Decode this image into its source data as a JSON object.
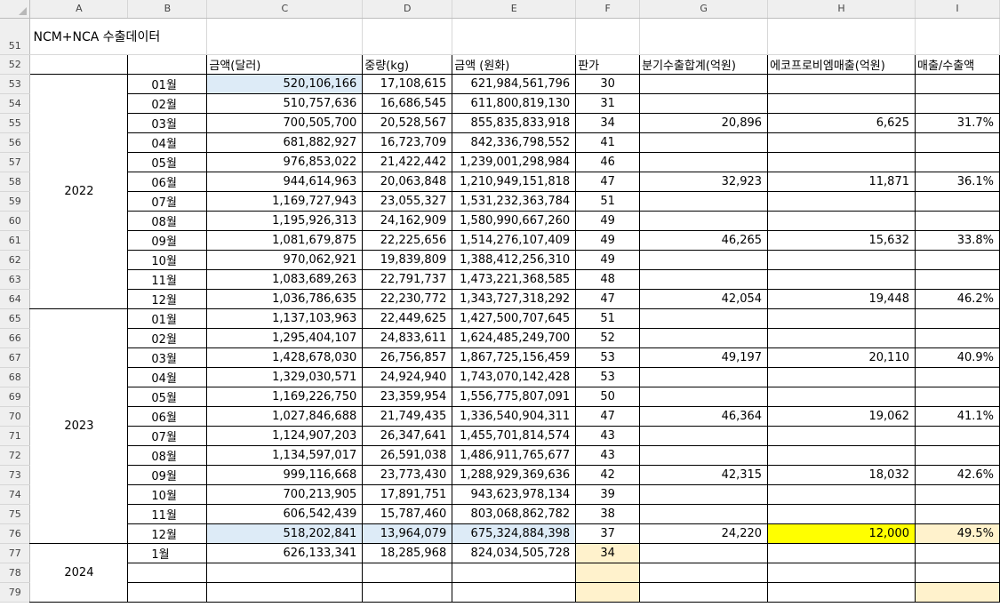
{
  "columns": [
    "A",
    "B",
    "C",
    "D",
    "E",
    "F",
    "G",
    "H",
    "I"
  ],
  "title_row": {
    "row_number": "51",
    "text": "NCM+NCA 수출데이터"
  },
  "header_row": {
    "row_number": "52",
    "labels": [
      "",
      "",
      "금액(달러)",
      "중량(kg)",
      "금액 (원화)",
      "판가",
      "분기수출합계(억원)",
      "에코프로비엠매출(억원)",
      "매출/수출액"
    ]
  },
  "years": [
    {
      "label": "2022",
      "row_start": 53,
      "row_span": 12
    },
    {
      "label": "2023",
      "row_start": 65,
      "row_span": 12
    },
    {
      "label": "2024",
      "row_start": 77,
      "row_span": 3
    }
  ],
  "rows": [
    {
      "n": "53",
      "month": "01월",
      "usd": "520,106,166",
      "kg": "17,108,615",
      "krw": "621,984,561,796",
      "price": "30",
      "q_total": "",
      "ecopro": "",
      "ratio": ""
    },
    {
      "n": "54",
      "month": "02월",
      "usd": "510,757,636",
      "kg": "16,686,545",
      "krw": "611,800,819,130",
      "price": "31",
      "q_total": "",
      "ecopro": "",
      "ratio": ""
    },
    {
      "n": "55",
      "month": "03월",
      "usd": "700,505,700",
      "kg": "20,528,567",
      "krw": "855,835,833,918",
      "price": "34",
      "q_total": "20,896",
      "ecopro": "6,625",
      "ratio": "31.7%"
    },
    {
      "n": "56",
      "month": "04월",
      "usd": "681,882,927",
      "kg": "16,723,709",
      "krw": "842,336,798,552",
      "price": "41",
      "q_total": "",
      "ecopro": "",
      "ratio": ""
    },
    {
      "n": "57",
      "month": "05월",
      "usd": "976,853,022",
      "kg": "21,422,442",
      "krw": "1,239,001,298,984",
      "price": "46",
      "q_total": "",
      "ecopro": "",
      "ratio": ""
    },
    {
      "n": "58",
      "month": "06월",
      "usd": "944,614,963",
      "kg": "20,063,848",
      "krw": "1,210,949,151,818",
      "price": "47",
      "q_total": "32,923",
      "ecopro": "11,871",
      "ratio": "36.1%"
    },
    {
      "n": "59",
      "month": "07월",
      "usd": "1,169,727,943",
      "kg": "23,055,327",
      "krw": "1,531,232,363,784",
      "price": "51",
      "q_total": "",
      "ecopro": "",
      "ratio": ""
    },
    {
      "n": "60",
      "month": "08월",
      "usd": "1,195,926,313",
      "kg": "24,162,909",
      "krw": "1,580,990,667,260",
      "price": "49",
      "q_total": "",
      "ecopro": "",
      "ratio": ""
    },
    {
      "n": "61",
      "month": "09월",
      "usd": "1,081,679,875",
      "kg": "22,225,656",
      "krw": "1,514,276,107,409",
      "price": "49",
      "q_total": "46,265",
      "ecopro": "15,632",
      "ratio": "33.8%"
    },
    {
      "n": "62",
      "month": "10월",
      "usd": "970,062,921",
      "kg": "19,839,809",
      "krw": "1,388,412,256,310",
      "price": "49",
      "q_total": "",
      "ecopro": "",
      "ratio": ""
    },
    {
      "n": "63",
      "month": "11월",
      "usd": "1,083,689,263",
      "kg": "22,791,737",
      "krw": "1,473,221,368,585",
      "price": "48",
      "q_total": "",
      "ecopro": "",
      "ratio": ""
    },
    {
      "n": "64",
      "month": "12월",
      "usd": "1,036,786,635",
      "kg": "22,230,772",
      "krw": "1,343,727,318,292",
      "price": "47",
      "q_total": "42,054",
      "ecopro": "19,448",
      "ratio": "46.2%"
    },
    {
      "n": "65",
      "month": "01월",
      "usd": "1,137,103,963",
      "kg": "22,449,625",
      "krw": "1,427,500,707,645",
      "price": "51",
      "q_total": "",
      "ecopro": "",
      "ratio": ""
    },
    {
      "n": "66",
      "month": "02월",
      "usd": "1,295,404,107",
      "kg": "24,833,611",
      "krw": "1,624,485,249,700",
      "price": "52",
      "q_total": "",
      "ecopro": "",
      "ratio": ""
    },
    {
      "n": "67",
      "month": "03월",
      "usd": "1,428,678,030",
      "kg": "26,756,857",
      "krw": "1,867,725,156,459",
      "price": "53",
      "q_total": "49,197",
      "ecopro": "20,110",
      "ratio": "40.9%"
    },
    {
      "n": "68",
      "month": "04월",
      "usd": "1,329,030,571",
      "kg": "24,924,940",
      "krw": "1,743,070,142,428",
      "price": "53",
      "q_total": "",
      "ecopro": "",
      "ratio": ""
    },
    {
      "n": "69",
      "month": "05월",
      "usd": "1,169,226,750",
      "kg": "23,359,954",
      "krw": "1,556,775,807,091",
      "price": "50",
      "q_total": "",
      "ecopro": "",
      "ratio": ""
    },
    {
      "n": "70",
      "month": "06월",
      "usd": "1,027,846,688",
      "kg": "21,749,435",
      "krw": "1,336,540,904,311",
      "price": "47",
      "q_total": "46,364",
      "ecopro": "19,062",
      "ratio": "41.1%"
    },
    {
      "n": "71",
      "month": "07월",
      "usd": "1,124,907,203",
      "kg": "26,347,641",
      "krw": "1,455,701,814,574",
      "price": "43",
      "q_total": "",
      "ecopro": "",
      "ratio": ""
    },
    {
      "n": "72",
      "month": "08월",
      "usd": "1,134,597,017",
      "kg": "26,591,038",
      "krw": "1,486,911,765,677",
      "price": "43",
      "q_total": "",
      "ecopro": "",
      "ratio": ""
    },
    {
      "n": "73",
      "month": "09월",
      "usd": "999,116,668",
      "kg": "23,773,430",
      "krw": "1,288,929,369,636",
      "price": "42",
      "q_total": "42,315",
      "ecopro": "18,032",
      "ratio": "42.6%"
    },
    {
      "n": "74",
      "month": "10월",
      "usd": "700,213,905",
      "kg": "17,891,751",
      "krw": "943,623,978,134",
      "price": "39",
      "q_total": "",
      "ecopro": "",
      "ratio": ""
    },
    {
      "n": "75",
      "month": "11월",
      "usd": "606,542,439",
      "kg": "15,787,460",
      "krw": "803,068,862,782",
      "price": "38",
      "q_total": "",
      "ecopro": "",
      "ratio": ""
    },
    {
      "n": "76",
      "month": "12월",
      "usd": "518,202,841",
      "kg": "13,964,079",
      "krw": "675,324,884,398",
      "price": "37",
      "q_total": "24,220",
      "ecopro": "12,000",
      "ratio": "49.5%"
    },
    {
      "n": "77",
      "month": "1월",
      "usd": "626,133,341",
      "kg": "18,285,968",
      "krw": "824,034,505,728",
      "price": "34",
      "q_total": "",
      "ecopro": "",
      "ratio": ""
    },
    {
      "n": "78",
      "month": "",
      "usd": "",
      "kg": "",
      "krw": "",
      "price": "",
      "q_total": "",
      "ecopro": "",
      "ratio": ""
    },
    {
      "n": "79",
      "month": "",
      "usd": "",
      "kg": "",
      "krw": "",
      "price": "",
      "q_total": "",
      "ecopro": "",
      "ratio": ""
    }
  ],
  "highlights": {
    "light_blue": "#ddebf7",
    "light_peach": "#fff2cc",
    "bright_yellow": "#ffff00"
  }
}
